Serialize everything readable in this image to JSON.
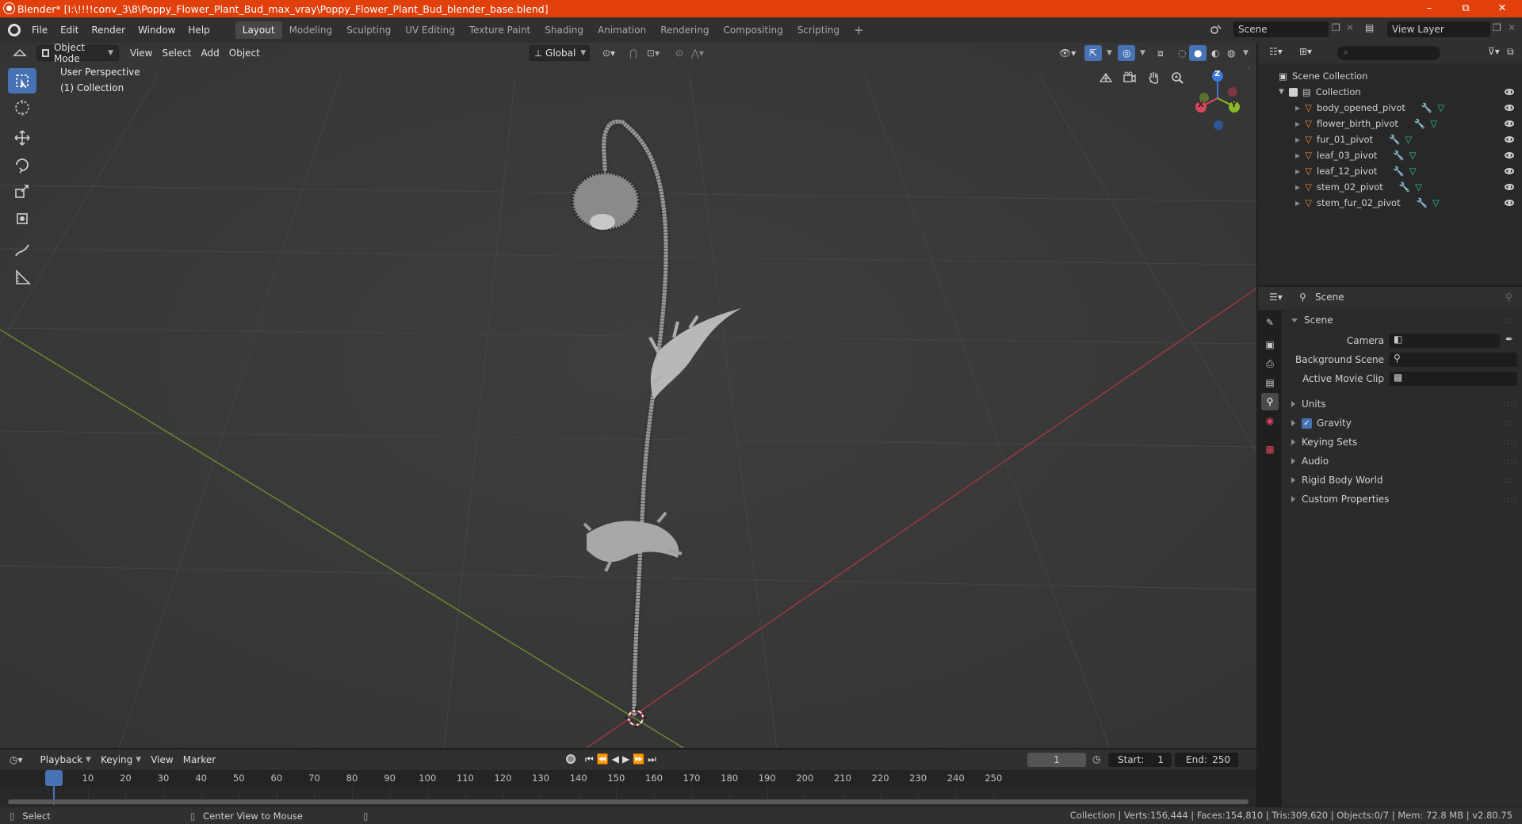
{
  "window": {
    "title": "Blender* [I:\\!!!!conv_3\\8\\Poppy_Flower_Plant_Bud_max_vray\\Poppy_Flower_Plant_Bud_blender_base.blend]",
    "minimize": "–",
    "restore": "⧉",
    "close": "✕"
  },
  "menu": {
    "items": [
      "File",
      "Edit",
      "Render",
      "Window",
      "Help"
    ],
    "workspaces": [
      "Layout",
      "Modeling",
      "Sculpting",
      "UV Editing",
      "Texture Paint",
      "Shading",
      "Animation",
      "Rendering",
      "Compositing",
      "Scripting"
    ],
    "active_workspace": "Layout",
    "add_workspace": "+",
    "scene_value": "Scene",
    "view_layer_value": "View Layer"
  },
  "viewport": {
    "mode": "Object Mode",
    "menus": [
      "View",
      "Select",
      "Add",
      "Object"
    ],
    "orientation": "Global",
    "overlay_line1": "User Perspective",
    "overlay_line2": "(1) Collection",
    "gizmo": {
      "z": "Z",
      "y": "Y",
      "x": "X"
    }
  },
  "outliner": {
    "search_placeholder": "",
    "root": "Scene Collection",
    "collection": "Collection",
    "objects": [
      "body_opened_pivot",
      "flower_birth_pivot",
      "fur_01_pivot",
      "leaf_03_pivot",
      "leaf_12_pivot",
      "stem_02_pivot",
      "stem_fur_02_pivot"
    ]
  },
  "properties": {
    "header_title": "Scene",
    "panel_title": "Scene",
    "fields": [
      {
        "label": "Camera",
        "value": ""
      },
      {
        "label": "Background Scene",
        "value": ""
      },
      {
        "label": "Active Movie Clip",
        "value": ""
      }
    ],
    "subpanels": [
      "Units",
      "Gravity",
      "Keying Sets",
      "Audio",
      "Rigid Body World",
      "Custom Properties"
    ],
    "gravity_checked": true
  },
  "timeline": {
    "menus": [
      "Playback",
      "Keying",
      "View",
      "Marker"
    ],
    "current_frame": "1",
    "start_label": "Start:",
    "start_value": "1",
    "end_label": "End:",
    "end_value": "250",
    "ticks": [
      "1",
      "10",
      "20",
      "30",
      "40",
      "50",
      "60",
      "70",
      "80",
      "90",
      "100",
      "110",
      "120",
      "130",
      "140",
      "150",
      "160",
      "170",
      "180",
      "190",
      "200",
      "210",
      "220",
      "230",
      "240",
      "250"
    ]
  },
  "statusbar": {
    "select": "Select",
    "center_view": "Center View to Mouse",
    "stats": "Collection | Verts:156,444 | Faces:154,810 | Tris:309,620 | Objects:0/7 | Mem: 72.8 MB | v2.80.75"
  },
  "colors": {
    "accent": "#4772b3",
    "titlebar": "#e1400c",
    "x_axis": "#9b3a44",
    "y_axis": "#6b8a2c",
    "object_icon": "#e8893a",
    "modifier_icon": "#6a9ce8",
    "mesh_icon": "#2fc7a0"
  }
}
